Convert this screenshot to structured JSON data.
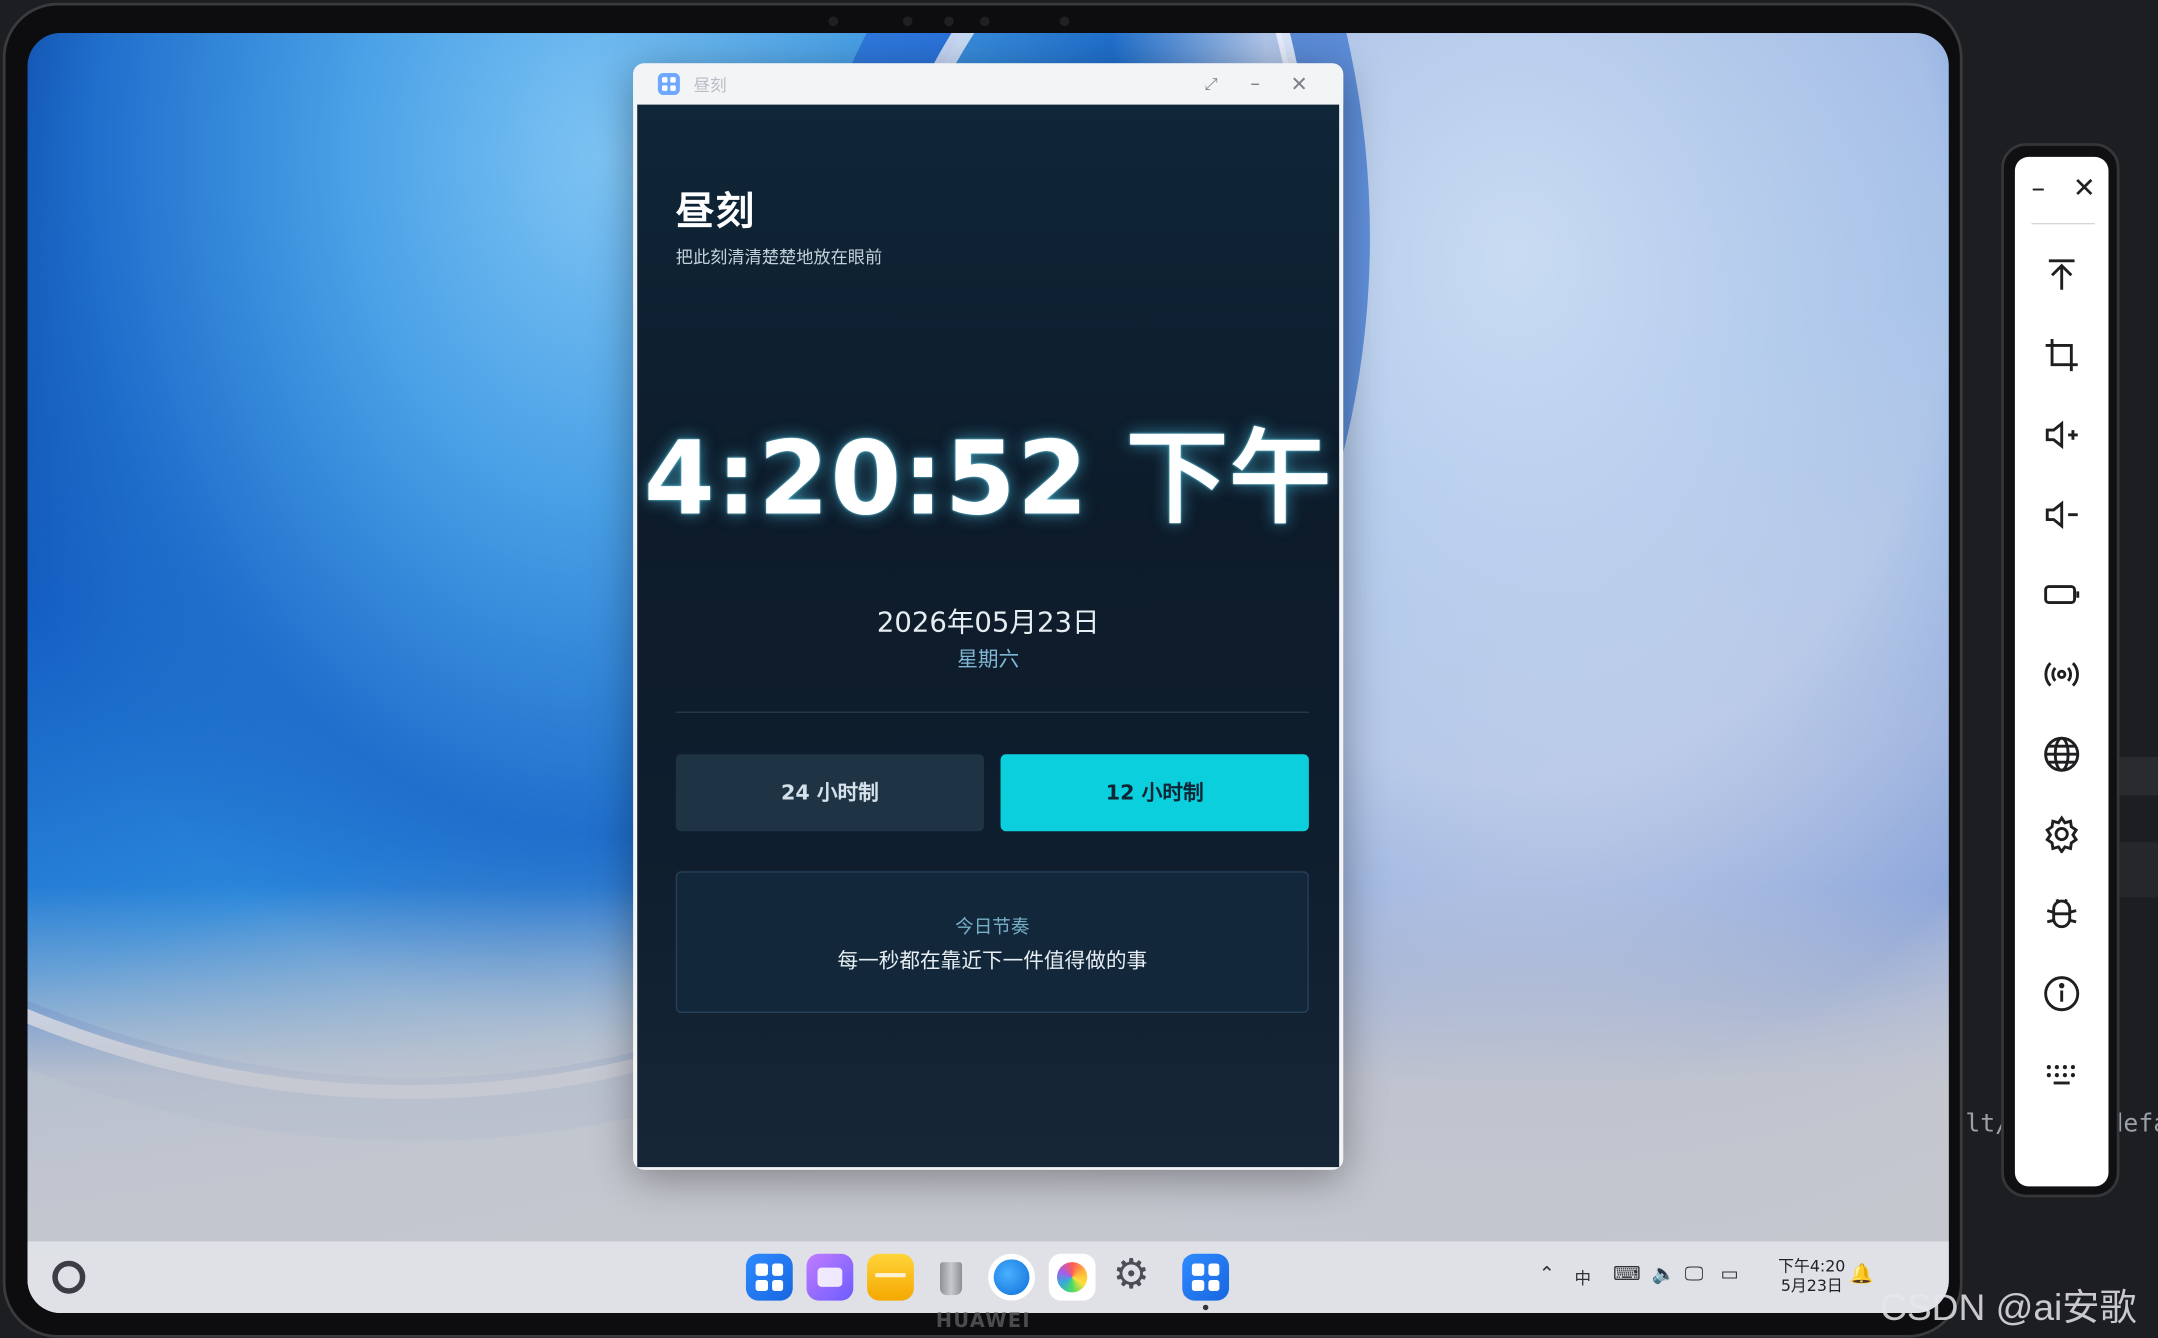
{
  "window": {
    "title": "昼刻",
    "controls": {
      "restore_icon": "restore-icon",
      "minimize_icon": "minimize-icon",
      "close_icon": "close-icon"
    }
  },
  "app": {
    "title": "昼刻",
    "subtitle": "把此刻清清楚楚地放在眼前",
    "time": "4:20:52 下午",
    "date": "2026年05月23日",
    "weekday": "星期六",
    "buttons": {
      "h24": "24 小时制",
      "h12": "12 小时制"
    },
    "active_mode": "12 小时制",
    "rhythm": {
      "label": "今日节奏",
      "text": "每一秒都在靠近下一件值得做的事"
    },
    "colors": {
      "accent": "#0bcfdc",
      "background": "#0d1b2a"
    }
  },
  "device": {
    "brand": "HUAWEI"
  },
  "taskbar": {
    "clock_time": "下午4:20",
    "clock_date": "5月23日",
    "dock_apps": [
      "app-center",
      "multi-window",
      "files",
      "trash",
      "browser",
      "gallery",
      "settings",
      "zhouke-app"
    ],
    "tray_icons": [
      "chevron-up-icon",
      "input-method-icon",
      "keyboard-icon",
      "volume-icon",
      "screen-cast-icon",
      "battery-icon",
      "bell-icon"
    ]
  },
  "emulator_toolbar": {
    "tools": [
      "top-icon",
      "crop-icon",
      "volume-up-icon",
      "volume-down-icon",
      "power-icon",
      "signal-icon",
      "globe-icon",
      "settings-icon",
      "bug-icon",
      "info-icon",
      "keyboard-icon"
    ]
  },
  "background_text": {
    "left": "lt/",
    "right": "defa"
  },
  "watermark": "CSDN @ai安歌"
}
